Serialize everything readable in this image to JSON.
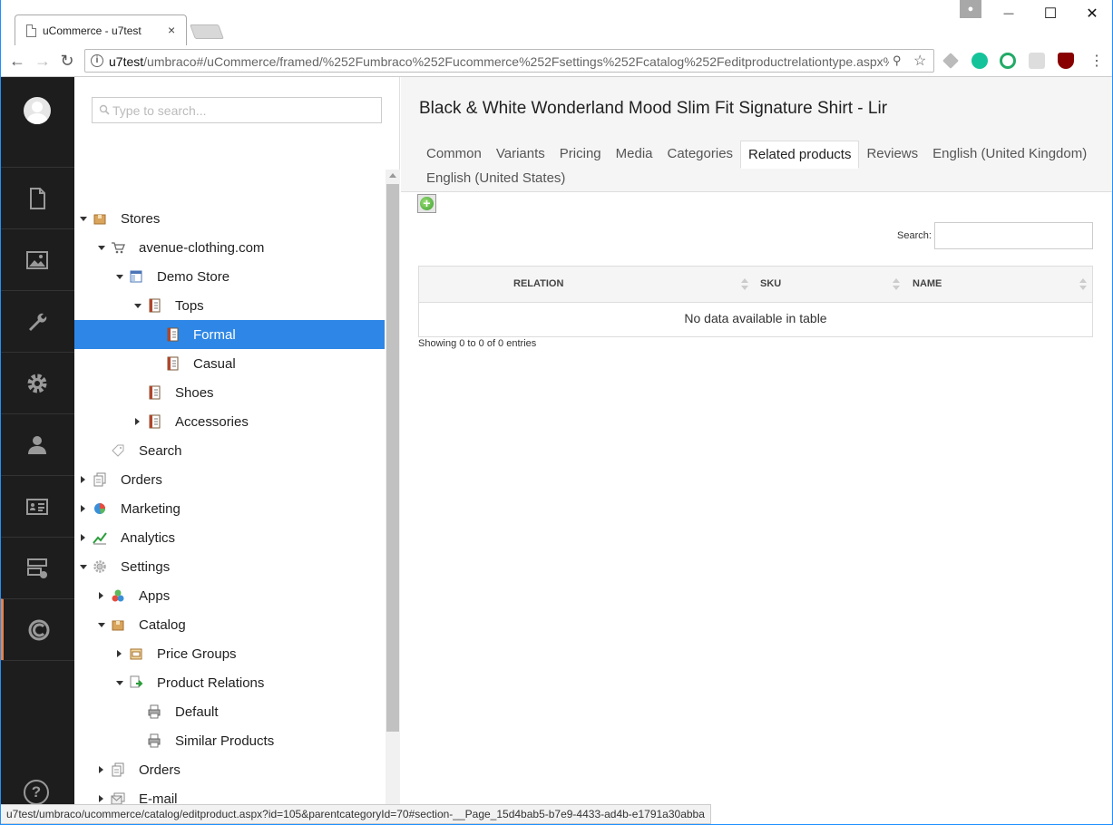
{
  "browser": {
    "tab_title": "uCommerce - u7test",
    "tab_close": "×",
    "window_controls": {
      "minimize": "—",
      "maximize": "☐",
      "close": "✕"
    },
    "url_host": "u7test",
    "url_path": "/umbraco#/uCommerce/framed/%252Fumbraco%252Fucommerce%252Fsettings%252Fcatalog%252Feditproductrelationtype.aspx%",
    "status_url": "u7test/umbraco/ucommerce/catalog/editproduct.aspx?id=105&parentcategoryId=70#section-__Page_15d4bab5-b7e9-4433-ad4b-e1791a30abba"
  },
  "app_sections": [
    {
      "name": "content",
      "icon": "document-icon"
    },
    {
      "name": "media",
      "icon": "image-icon"
    },
    {
      "name": "settings",
      "icon": "wrench-icon"
    },
    {
      "name": "developer",
      "icon": "gear-icon"
    },
    {
      "name": "users",
      "icon": "user-icon"
    },
    {
      "name": "members",
      "icon": "id-card-icon"
    },
    {
      "name": "forms",
      "icon": "forms-icon"
    },
    {
      "name": "ucommerce",
      "icon": "ucommerce-icon",
      "active": true
    }
  ],
  "tree": {
    "search_placeholder": "Type to search...",
    "items": [
      {
        "label": "Stores",
        "level": 0,
        "arrow": "down",
        "icon": "box-icon"
      },
      {
        "label": "avenue-clothing.com",
        "level": 1,
        "arrow": "down",
        "icon": "cart-icon"
      },
      {
        "label": "Demo Store",
        "level": 2,
        "arrow": "down",
        "icon": "store-icon"
      },
      {
        "label": "Tops",
        "level": 3,
        "arrow": "down",
        "icon": "catalog-icon"
      },
      {
        "label": "Formal",
        "level": 4,
        "arrow": "",
        "icon": "catalog-icon",
        "selected": true
      },
      {
        "label": "Casual",
        "level": 4,
        "arrow": "",
        "icon": "catalog-icon"
      },
      {
        "label": "Shoes",
        "level": 3,
        "arrow": "",
        "icon": "catalog-icon"
      },
      {
        "label": "Accessories",
        "level": 3,
        "arrow": "right",
        "icon": "catalog-icon"
      },
      {
        "label": "Search",
        "level": 1,
        "arrow": "",
        "icon": "tag-icon"
      },
      {
        "label": "Orders",
        "level": 0,
        "arrow": "right",
        "icon": "orders-icon"
      },
      {
        "label": "Marketing",
        "level": 0,
        "arrow": "right",
        "icon": "pie-icon"
      },
      {
        "label": "Analytics",
        "level": 0,
        "arrow": "right",
        "icon": "analytics-icon"
      },
      {
        "label": "Settings",
        "level": 0,
        "arrow": "down",
        "icon": "cog-icon"
      },
      {
        "label": "Apps",
        "level": 1,
        "arrow": "right",
        "icon": "apps-icon"
      },
      {
        "label": "Catalog",
        "level": 1,
        "arrow": "down",
        "icon": "box-icon"
      },
      {
        "label": "Price Groups",
        "level": 2,
        "arrow": "right",
        "icon": "price-icon"
      },
      {
        "label": "Product Relations",
        "level": 2,
        "arrow": "down",
        "icon": "relation-icon"
      },
      {
        "label": "Default",
        "level": 3,
        "arrow": "",
        "icon": "printer-icon"
      },
      {
        "label": "Similar Products",
        "level": 3,
        "arrow": "",
        "icon": "printer-icon"
      },
      {
        "label": "Orders",
        "level": 1,
        "arrow": "right",
        "icon": "orders-icon"
      },
      {
        "label": "E-mail",
        "level": 1,
        "arrow": "right",
        "icon": "email-icon"
      }
    ]
  },
  "main": {
    "title": "Black & White Wonderland Mood Slim Fit Signature Shirt - Lir",
    "tabs_row1": [
      "Common",
      "Variants",
      "Pricing",
      "Media",
      "Categories",
      "Related products",
      "Reviews",
      "English (United Kingdom)"
    ],
    "tabs_row2": [
      "English (United States)"
    ],
    "active_tab": "Related products",
    "search_label": "Search:",
    "search_value": "",
    "table": {
      "columns": [
        "RELATION",
        "SKU",
        "NAME"
      ],
      "empty_message": "No data available in table",
      "info": "Showing 0 to 0 of 0 entries"
    }
  },
  "colors": {
    "nav_bg": "#1d1d1d",
    "accent": "#e8834a",
    "selected": "#2e87e6"
  }
}
